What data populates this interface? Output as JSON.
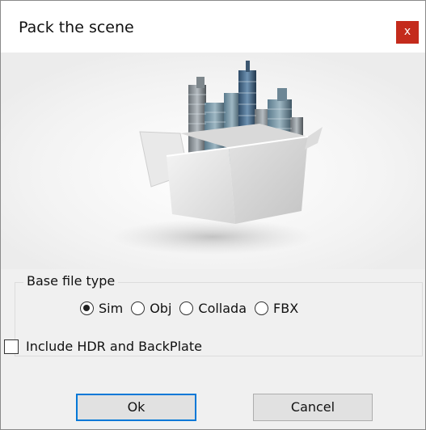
{
  "window": {
    "title": "Pack the scene",
    "close_glyph": "x"
  },
  "banner": {
    "icon": "box-with-city-buildings-icon"
  },
  "base_file_type": {
    "legend": "Base file type",
    "options": [
      {
        "label": "Sim",
        "selected": true
      },
      {
        "label": "Obj",
        "selected": false
      },
      {
        "label": "Collada",
        "selected": false
      },
      {
        "label": "FBX",
        "selected": false
      }
    ]
  },
  "include_hdr": {
    "label": "Include HDR and BackPlate",
    "checked": false
  },
  "buttons": {
    "ok_label": "Ok",
    "cancel_label": "Cancel"
  },
  "colors": {
    "close_button": "#c42b1c",
    "default_button_border": "#0078d7",
    "dialog_background": "#f0f0f0"
  }
}
